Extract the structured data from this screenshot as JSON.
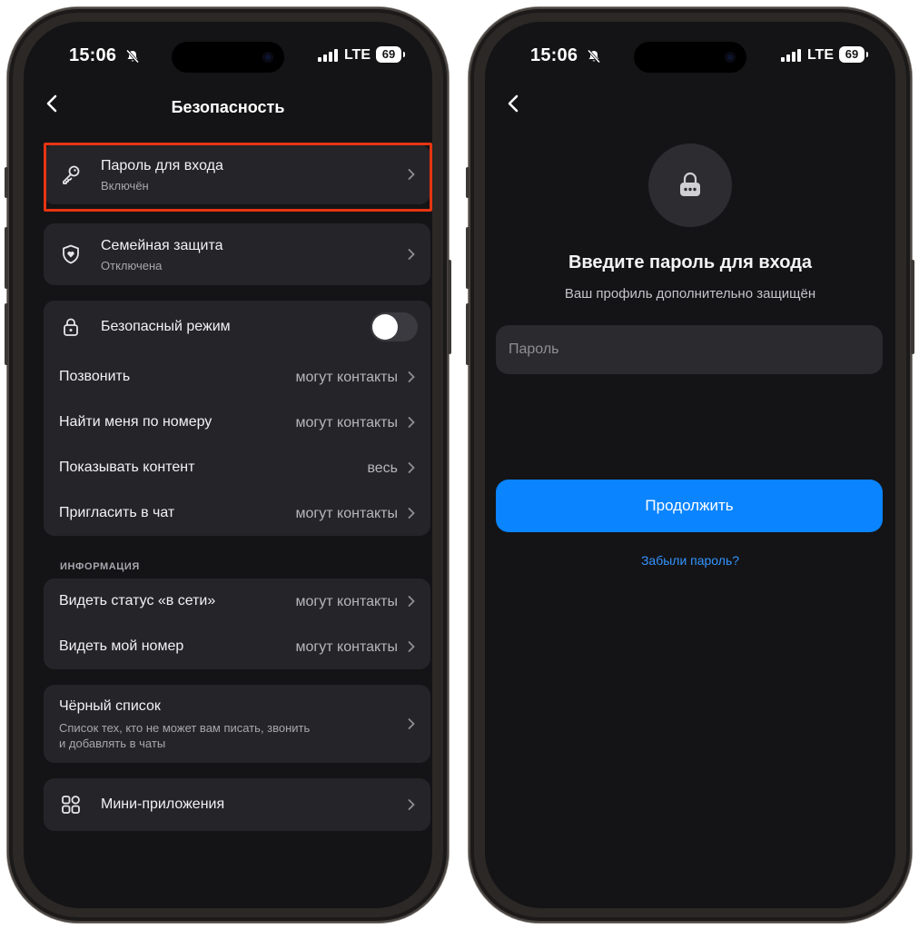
{
  "status": {
    "time": "15:06",
    "network": "LTE",
    "battery": "69"
  },
  "left_screen": {
    "title": "Безопасность",
    "login_password": {
      "title": "Пароль для входа",
      "subtitle": "Включён"
    },
    "family_protection": {
      "title": "Семейная защита",
      "subtitle": "Отключена"
    },
    "safe_mode": {
      "title": "Безопасный режим",
      "enabled": false
    },
    "privacy_rows": [
      {
        "label": "Позвонить",
        "value": "могут контакты"
      },
      {
        "label": "Найти меня по номеру",
        "value": "могут контакты"
      },
      {
        "label": "Показывать контент",
        "value": "весь"
      },
      {
        "label": "Пригласить в чат",
        "value": "могут контакты"
      }
    ],
    "info_section": {
      "label": "ИНФОРМАЦИЯ",
      "rows": [
        {
          "label": "Видеть статус «в сети»",
          "value": "могут контакты"
        },
        {
          "label": "Видеть мой номер",
          "value": "могут контакты"
        }
      ]
    },
    "blacklist": {
      "title": "Чёрный список",
      "description_line1": "Список тех, кто не может вам писать, звонить",
      "description_line2": "и добавлять в чаты"
    },
    "mini_apps": {
      "title": "Мини-приложения"
    }
  },
  "right_screen": {
    "title": "Введите пароль для входа",
    "subtitle": "Ваш профиль дополнительно защищён",
    "password_placeholder": "Пароль",
    "continue_label": "Продолжить",
    "forgot_label": "Забыли пароль?"
  },
  "colors": {
    "background": "#141416",
    "card": "#252529",
    "accent": "#0a84ff",
    "highlight": "#e63412"
  }
}
